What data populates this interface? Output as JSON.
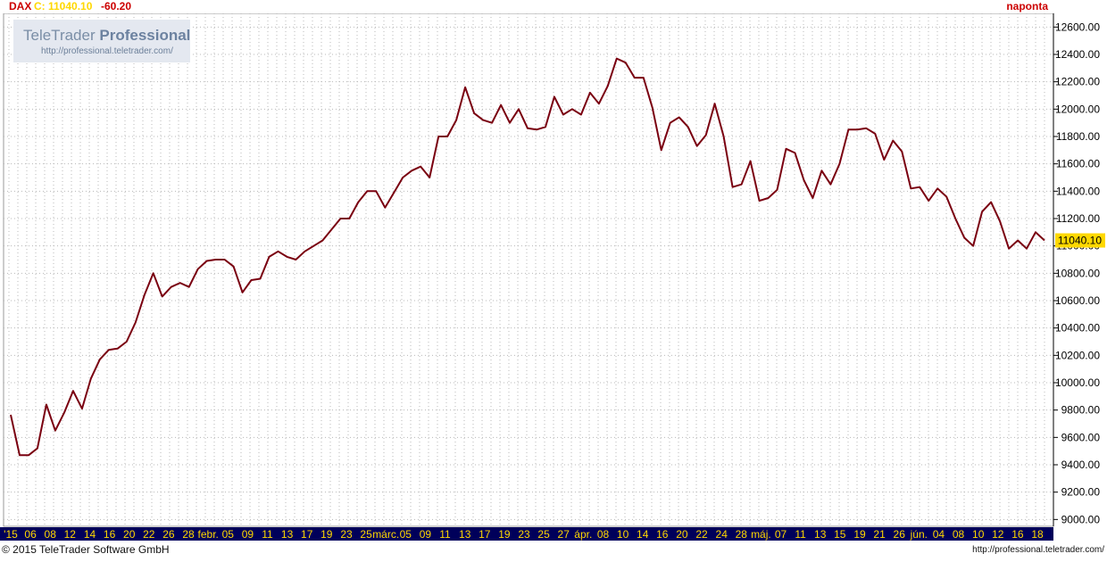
{
  "header": {
    "symbol": "DAX",
    "close_label": "C: 11040.10",
    "change": "-60.20",
    "interval": "naponta"
  },
  "watermark": {
    "brand": "TeleTrader",
    "brand_bold": "Professional",
    "url": "http://professional.teletrader.com/"
  },
  "footer": {
    "copyright": "© 2015 TeleTrader Software GmbH",
    "url": "http://professional.teletrader.com/"
  },
  "colors": {
    "line": "#7a0010",
    "axis_strip": "#00005a",
    "axis_text": "#ffd800",
    "grid": "#b8b8b8",
    "last_price_badge": "#ffd800",
    "header_red": "#cc0000"
  },
  "chart_data": {
    "type": "line",
    "title": "",
    "xlabel": "",
    "ylabel": "",
    "ylim": [
      8950,
      12700
    ],
    "yticks": [
      9000,
      9200,
      9400,
      9600,
      9800,
      10000,
      10200,
      10400,
      10600,
      10800,
      11000,
      11200,
      11400,
      11600,
      11800,
      12000,
      12200,
      12400,
      12600
    ],
    "ytick_labels": [
      "9000.00",
      "9200.00",
      "9400.00",
      "9600.00",
      "9800.00",
      "10000.00",
      "10200.00",
      "10400.00",
      "10600.00",
      "10800.00",
      "11000.00",
      "11200.00",
      "11400.00",
      "11600.00",
      "11800.00",
      "12000.00",
      "12200.00",
      "12400.00",
      "12600.00"
    ],
    "last_price_label": "11040.10",
    "last_value": 11040.1,
    "grid": true,
    "x_labels": [
      "'15",
      "06",
      "08",
      "12",
      "14",
      "16",
      "20",
      "22",
      "26",
      "28",
      "febr.",
      "05",
      "09",
      "11",
      "13",
      "17",
      "19",
      "23",
      "25",
      "márc.",
      "05",
      "09",
      "11",
      "13",
      "17",
      "19",
      "23",
      "25",
      "27",
      "ápr.",
      "08",
      "10",
      "14",
      "16",
      "20",
      "22",
      "24",
      "28",
      "máj.",
      "07",
      "11",
      "13",
      "15",
      "19",
      "21",
      "26",
      "jún.",
      "04",
      "08",
      "10",
      "12",
      "16",
      "18"
    ],
    "series": [
      {
        "values": [
          9765,
          9470,
          9470,
          9520,
          9840,
          9650,
          9780,
          9940,
          9810,
          10030,
          10170,
          10240,
          10250,
          10300,
          10440,
          10640,
          10800,
          10630,
          10700,
          10730,
          10700,
          10830,
          10890,
          10900,
          10900,
          10850,
          10660,
          10750,
          10760,
          10920,
          10960,
          10920,
          10900,
          10960,
          11000,
          11040,
          11120,
          11200,
          11200,
          11320,
          11400,
          11400,
          11280,
          11390,
          11500,
          11550,
          11580,
          11500,
          11800,
          11800,
          11920,
          12160,
          11970,
          11920,
          11900,
          12030,
          11900,
          12000,
          11860,
          11850,
          11870,
          12090,
          11960,
          12000,
          11960,
          12120,
          12040,
          12170,
          12370,
          12340,
          12230,
          12230,
          12010,
          11700,
          11900,
          11940,
          11870,
          11730,
          11810,
          12040,
          11800,
          11430,
          11450,
          11620,
          11330,
          11350,
          11410,
          11710,
          11680,
          11480,
          11350,
          11550,
          11450,
          11600,
          11850,
          11850,
          11860,
          11820,
          11630,
          11770,
          11690,
          11420,
          11430,
          11330,
          11420,
          11360,
          11200,
          11060,
          11000,
          11250,
          11320,
          11180,
          10980,
          11040,
          10980,
          11100,
          11040
        ]
      }
    ]
  }
}
